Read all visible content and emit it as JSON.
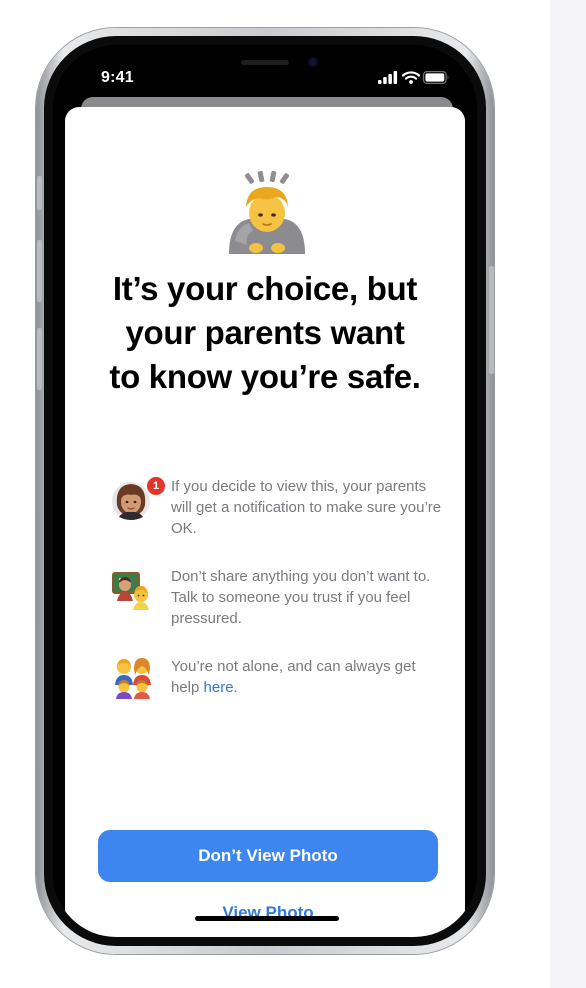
{
  "status_bar": {
    "time": "9:41",
    "signal_icon": "cellular-signal-icon",
    "wifi_icon": "wifi-icon",
    "battery_icon": "battery-icon"
  },
  "hero": {
    "icon": "person-bowing-emoji",
    "title_lines": [
      "It’s your choice, but",
      "your parents want",
      "to know you’re safe."
    ]
  },
  "bullets": [
    {
      "icon": "parent-notification-avatar-icon",
      "badge": "1",
      "text": "If you decide to view this, your parents will get a notification to make sure you’re OK."
    },
    {
      "icon": "teacher-and-child-icon",
      "text": "Don’t share anything you don’t want to. Talk to someone you trust if you feel pressured."
    },
    {
      "icon": "family-icon",
      "text": "You’re not alone, and can always get help",
      "link": "here."
    }
  ],
  "actions": {
    "primary_label": "Don’t View Photo",
    "secondary_label": "View Photo"
  },
  "colors": {
    "primary_button": "#3d86f0",
    "link": "#2f7bd8",
    "body_text": "#7a7a7f",
    "badge": "#e0362c"
  }
}
